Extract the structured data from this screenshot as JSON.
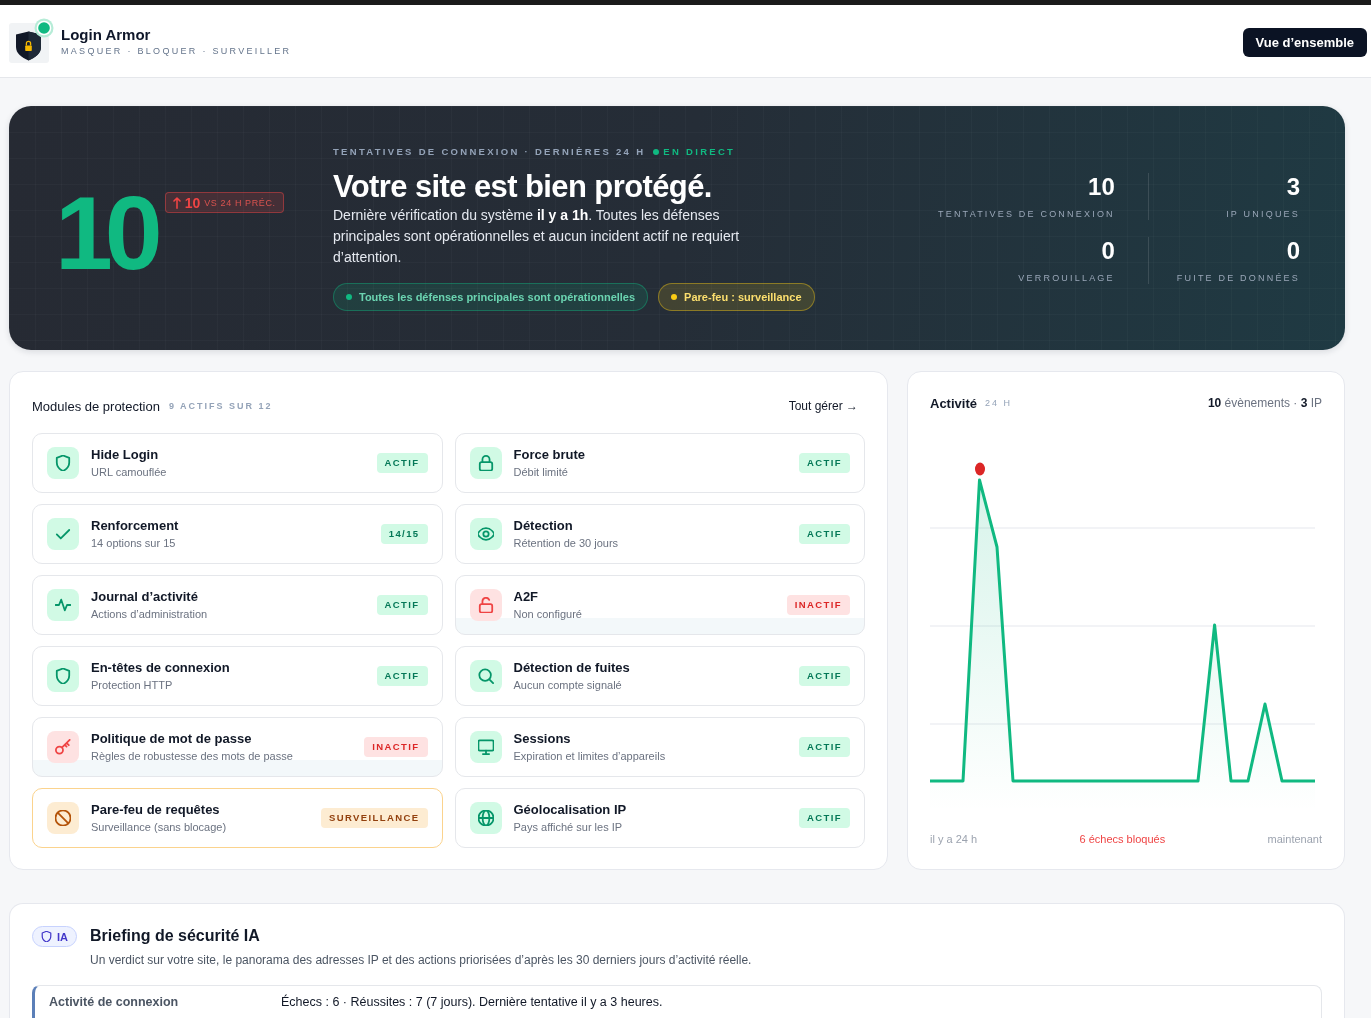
{
  "header": {
    "brand": {
      "name": "Login Armor",
      "tagline": "MASQUER · BLOQUER · SURVEILLER"
    },
    "button": "Vue d’ensemble"
  },
  "hero": {
    "score": "10",
    "delta": {
      "value": "10",
      "caption": "VS 24 H PRÉC."
    },
    "eyebrow": "TENTATIVES DE CONNEXION · DERNIÈRES 24 H",
    "live": "EN DIRECT",
    "title": "Votre site est bien protégé.",
    "description": "Dernière vérification du système **il y a 1h**. Toutes les défenses principales sont opérationnelles et aucun incident actif ne requiert d’attention.",
    "pills": [
      {
        "label": "Toutes les défenses principales sont opérationnelles",
        "color": "#10b981"
      },
      {
        "label": "Pare-feu : surveillance",
        "color": "#facc15"
      }
    ],
    "stats": [
      {
        "value": "10",
        "label": "TENTATIVES DE CONNEXION"
      },
      {
        "value": "3",
        "label": "IP UNIQUES"
      },
      {
        "value": "0",
        "label": "VERROUILLAGE"
      },
      {
        "value": "0",
        "label": "FUITE DE DONNÉES"
      }
    ]
  },
  "modules": {
    "title": "Modules de protection",
    "count": "9 ACTIFS SUR 12",
    "link": "Tout gérer →",
    "items": [
      {
        "name": "Hide Login",
        "detail": "URL camouflée",
        "kind": "active",
        "badge": "ACTIF"
      },
      {
        "name": "Force brute",
        "detail": "Débit limité",
        "kind": "active",
        "badge": "ACTIF"
      },
      {
        "name": "Renforcement",
        "detail": "14 options sur 15",
        "kind": "active",
        "badge": "14/15"
      },
      {
        "name": "Détection",
        "detail": "Rétention de 30 jours",
        "kind": "active",
        "badge": "ACTIF"
      },
      {
        "name": "Journal d’activité",
        "detail": "Actions d’administration",
        "kind": "active",
        "badge": "ACTIF"
      },
      {
        "name": "A2F",
        "detail": "Non configuré",
        "kind": "inactive",
        "badge": "INACTIF"
      },
      {
        "name": "En-têtes de connexion",
        "detail": "Protection HTTP",
        "kind": "active",
        "badge": "ACTIF"
      },
      {
        "name": "Détection de fuites",
        "detail": "Aucun compte signalé",
        "kind": "active",
        "badge": "ACTIF"
      },
      {
        "name": "Politique de mot de passe",
        "detail": "Règles de robustesse des mots de passe",
        "kind": "inactive",
        "badge": "INACTIF"
      },
      {
        "name": "Sessions",
        "detail": "Expiration et limites d’appareils",
        "kind": "active",
        "badge": "ACTIF"
      },
      {
        "name": "Pare-feu de requêtes",
        "detail": "Surveillance (sans blocage)",
        "kind": "monitoring",
        "badge": "SURVEILLANCE"
      },
      {
        "name": "Géolocalisation IP",
        "detail": "Pays affiché sur les IP",
        "kind": "active",
        "badge": "ACTIF"
      }
    ]
  },
  "activity": {
    "title": "Activité",
    "period": "24 H",
    "summary": "**10** évènements · **3** IP",
    "axis_start": "il y a 24 h",
    "failures": "6 échecs bloqués",
    "axis_end": "maintenant"
  },
  "briefing": {
    "badge": "IA",
    "title": "Briefing de sécurité IA",
    "subtitle": "Un verdict sur votre site, le panorama des adresses IP et des actions priorisées d’après les 30 derniers jours d’activité réelle.",
    "rows": [
      {
        "label": "Activité de connexion",
        "value": "Échecs : 6 · Réussites : 7 (7 jours). Dernière tentative il y a 3 heures."
      }
    ]
  }
}
